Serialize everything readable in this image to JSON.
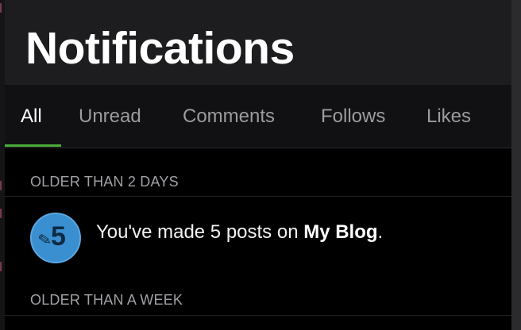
{
  "page": {
    "title": "Notifications"
  },
  "tabs": [
    {
      "label": "All",
      "active": true
    },
    {
      "label": "Unread",
      "active": false
    },
    {
      "label": "Comments",
      "active": false
    },
    {
      "label": "Follows",
      "active": false
    },
    {
      "label": "Likes",
      "active": false
    }
  ],
  "sections": [
    {
      "header": "OLDER THAN 2 DAYS",
      "notifications": [
        {
          "icon": "pencil-icon",
          "badge_number": "5",
          "text_prefix": "You've made 5 posts on ",
          "blog_name": "My Blog",
          "text_suffix": "."
        }
      ]
    },
    {
      "header": "OLDER THAN A WEEK",
      "notifications": []
    }
  ],
  "colors": {
    "accent": "#4bad3a",
    "badge": "#3a8fd0",
    "background": "#000000",
    "header_bg": "#1d1d1f"
  }
}
